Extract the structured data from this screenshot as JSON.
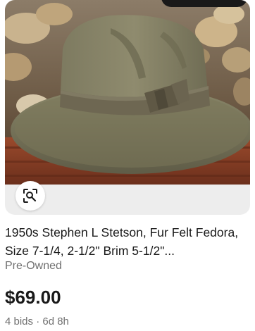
{
  "listing": {
    "title": "1950s Stephen L Stetson, Fur Felt Fedora, Size 7-1/4, 2-1/2\" Brim 5-1/2\"...",
    "condition": "Pre-Owned",
    "price": "$69.00",
    "meta": "4 bids · 6d 8h"
  },
  "icons": {
    "visual_search": "visual-search-icon"
  },
  "colors": {
    "text_primary": "#191919",
    "text_secondary": "#707070",
    "image_background": "#ededed"
  }
}
